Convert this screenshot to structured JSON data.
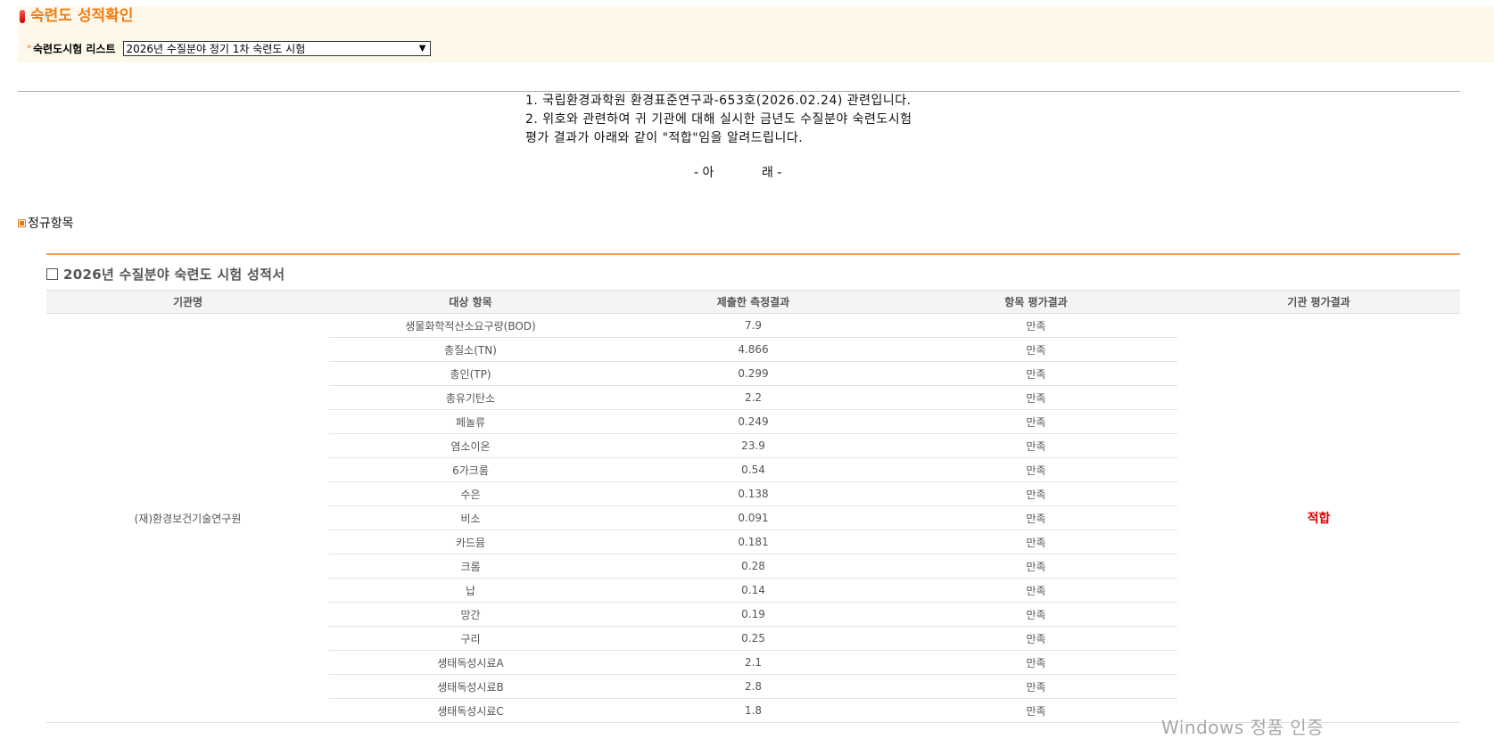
{
  "header": {
    "title": "숙련도 성적확인",
    "select_label": "숙련도시험 리스트",
    "select_value": "2026년 수질분야 정기 1차 숙련도 시험"
  },
  "notice": {
    "line1": "1. 국립환경과학원 환경표준연구과-653호(2026.02.24) 관련입니다.",
    "line2": "2. 위호와 관련하여 귀 기관에 대해 실시한 금년도 수질분야 숙련도시험",
    "line3": "평가 결과가 아래와 같이 \"적합\"임을 알려드립니다.",
    "below_left": "- 아",
    "below_right": "래 -"
  },
  "section_title": "정규항목",
  "report": {
    "title": "2026년 수질분야 숙련도 시험 성적서",
    "columns": [
      "기관명",
      "대상 항목",
      "제출한 측정결과",
      "항목 평가결과",
      "기관 평가결과"
    ],
    "org_name": "(재)환경보건기술연구원",
    "org_result": "적합",
    "rows": [
      {
        "item": "생물화학적산소요구량(BOD)",
        "value": "7.9",
        "eval": "만족"
      },
      {
        "item": "총질소(TN)",
        "value": "4.866",
        "eval": "만족"
      },
      {
        "item": "총인(TP)",
        "value": "0.299",
        "eval": "만족"
      },
      {
        "item": "총유기탄소",
        "value": "2.2",
        "eval": "만족"
      },
      {
        "item": "페놀류",
        "value": "0.249",
        "eval": "만족"
      },
      {
        "item": "염소이온",
        "value": "23.9",
        "eval": "만족"
      },
      {
        "item": "6가크롬",
        "value": "0.54",
        "eval": "만족"
      },
      {
        "item": "수은",
        "value": "0.138",
        "eval": "만족"
      },
      {
        "item": "비소",
        "value": "0.091",
        "eval": "만족"
      },
      {
        "item": "카드뮴",
        "value": "0.181",
        "eval": "만족"
      },
      {
        "item": "크롬",
        "value": "0.28",
        "eval": "만족"
      },
      {
        "item": "납",
        "value": "0.14",
        "eval": "만족"
      },
      {
        "item": "망간",
        "value": "0.19",
        "eval": "만족"
      },
      {
        "item": "구리",
        "value": "0.25",
        "eval": "만족"
      },
      {
        "item": "생태독성시료A",
        "value": "2.1",
        "eval": "만족"
      },
      {
        "item": "생태독성시료B",
        "value": "2.8",
        "eval": "만족"
      },
      {
        "item": "생태독성시료C",
        "value": "1.8",
        "eval": "만족"
      }
    ]
  },
  "watermark": "Windows 정품 인증"
}
